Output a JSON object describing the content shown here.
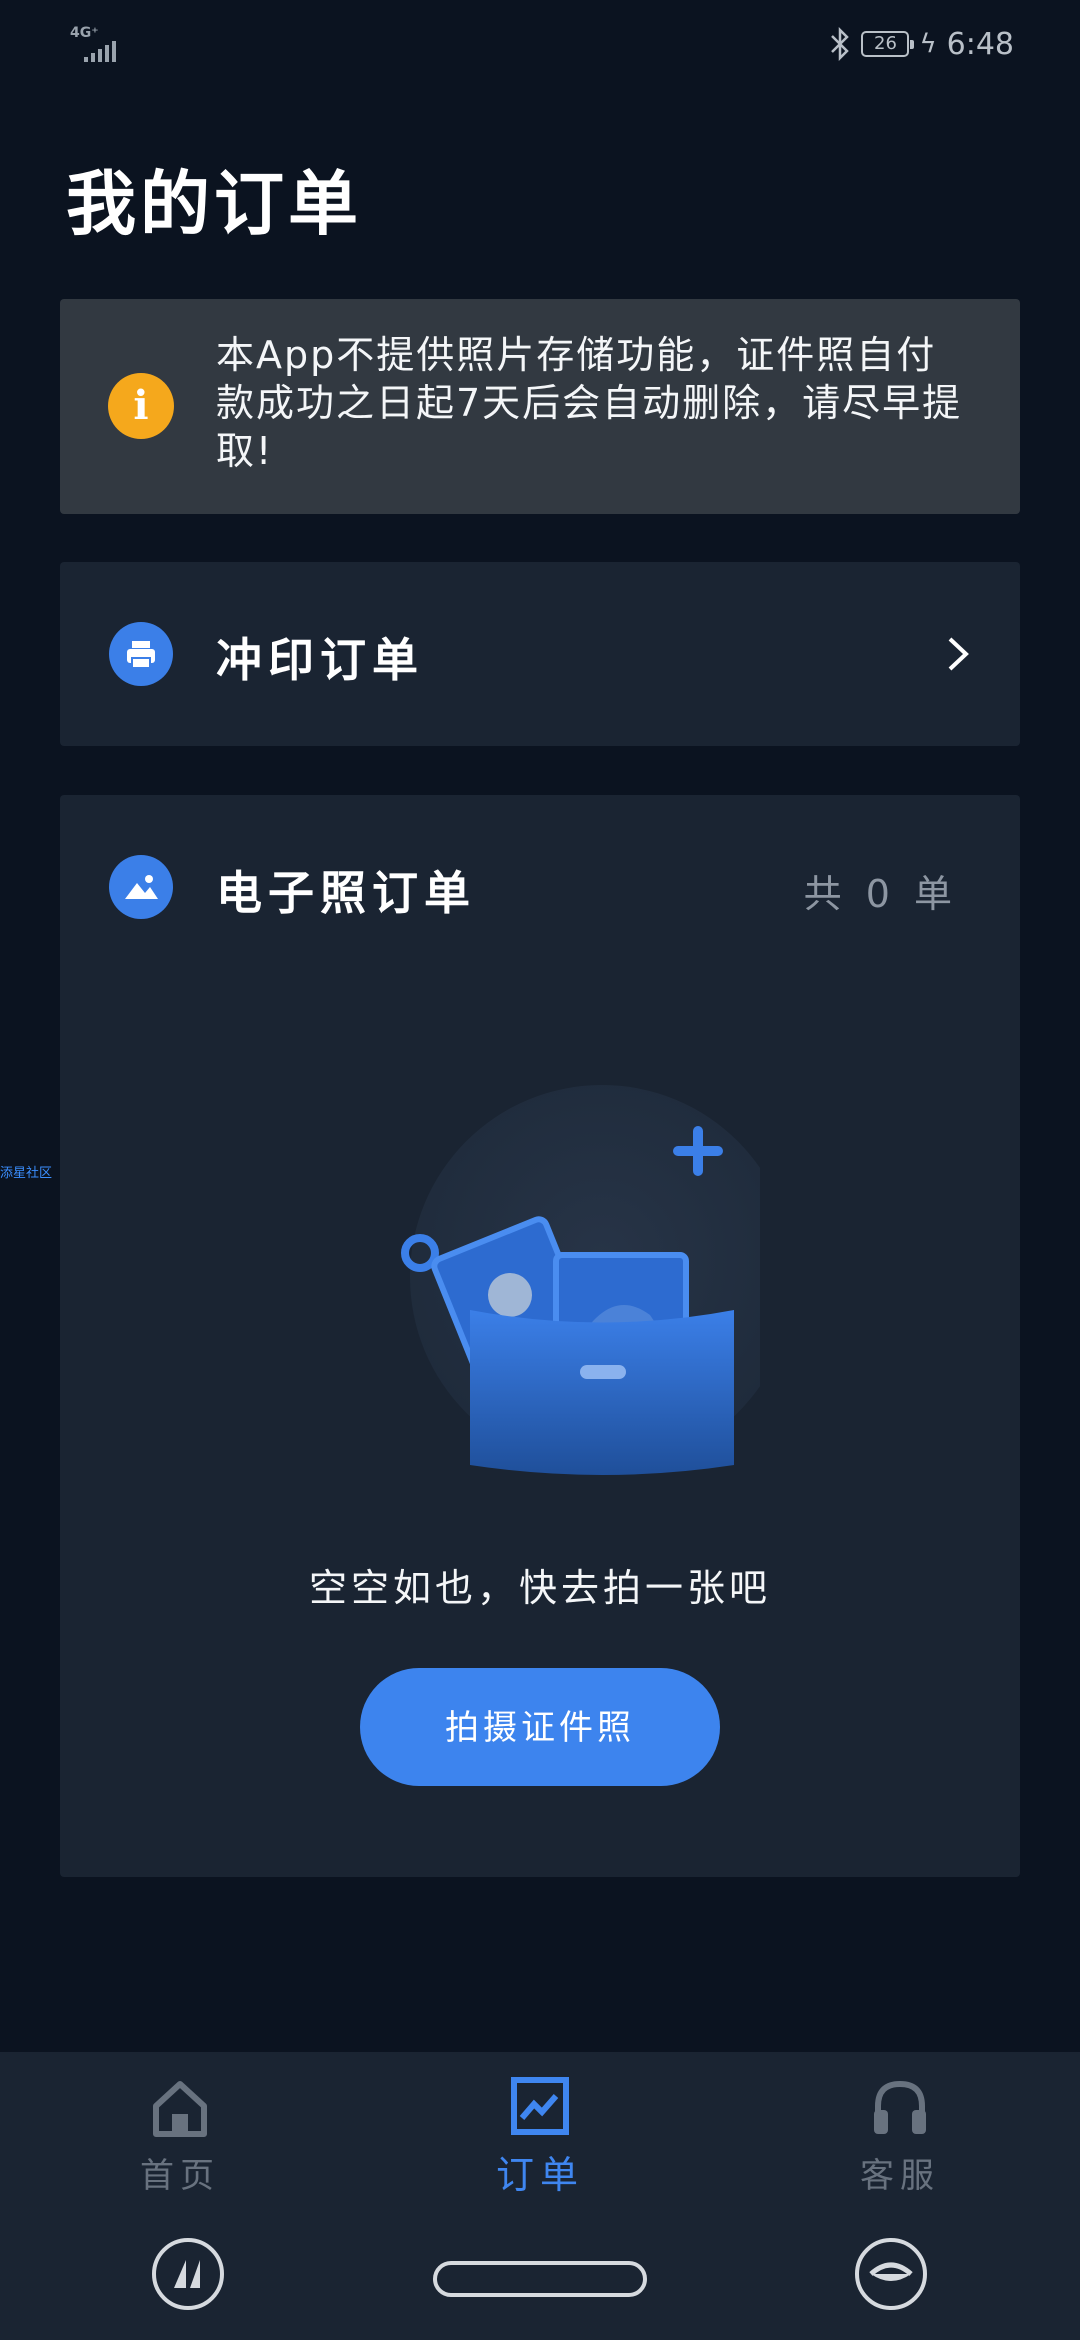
{
  "status_bar": {
    "network": "4G⁺",
    "battery": "26",
    "time": "6:48"
  },
  "page_title": "我的订单",
  "notice": {
    "icon": "info-icon",
    "text": "本App不提供照片存储功能，证件照自付款成功之日起7天后会自动删除，请尽早提取!"
  },
  "print_order": {
    "icon": "printer-icon",
    "label": "冲印订单"
  },
  "photo_order": {
    "icon": "image-icon",
    "label": "电子照订单",
    "count_text": "共 0 单"
  },
  "empty_state": {
    "text": "空空如也，快去拍一张吧",
    "button_label": "拍摄证件照"
  },
  "side_tag": "添星社区",
  "tabs": [
    {
      "label": "首页",
      "icon": "home-icon",
      "active": false
    },
    {
      "label": "订单",
      "icon": "chart-icon",
      "active": true
    },
    {
      "label": "客服",
      "icon": "headset-icon",
      "active": false
    }
  ],
  "colors": {
    "background": "#0b1320",
    "card": "#1a2432",
    "notice_bg": "#323941",
    "accent": "#3d84ee",
    "warning": "#f5a81c"
  }
}
